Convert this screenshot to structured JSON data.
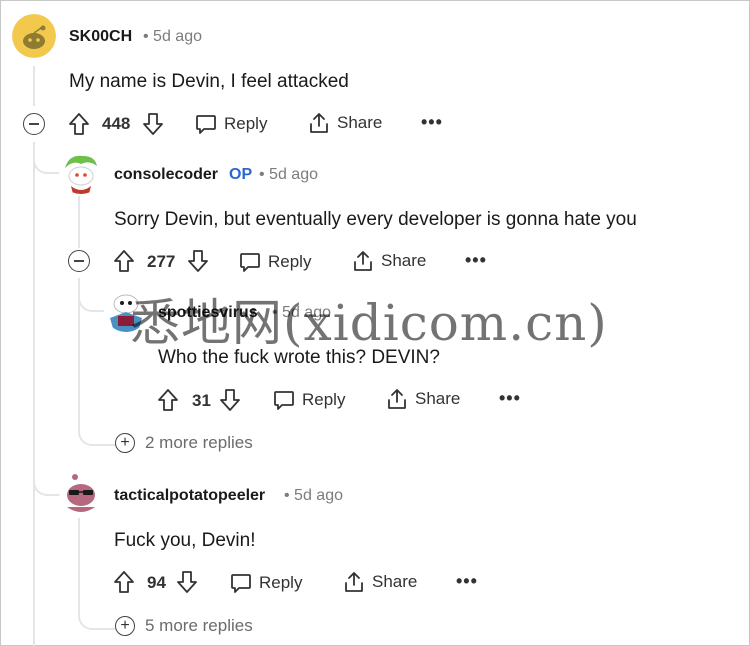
{
  "comments": [
    {
      "author": "SK00CH",
      "time": "• 5d ago",
      "body": "My name is Devin, I feel attacked",
      "votes": "448",
      "reply_label": "Reply",
      "share_label": "Share",
      "more_label": "•••"
    },
    {
      "author": "consolecoder",
      "op_badge": "OP",
      "time": "• 5d ago",
      "body": "Sorry Devin, but eventually every developer is gonna hate you",
      "votes": "277",
      "reply_label": "Reply",
      "share_label": "Share",
      "more_label": "•••"
    },
    {
      "author": "spottiesvirus",
      "time": "• 5d ago",
      "body": "Who the fuck wrote this? DEVIN?",
      "votes": "31",
      "reply_label": "Reply",
      "share_label": "Share",
      "more_label": "•••",
      "more_replies": "2 more replies"
    },
    {
      "author": "tacticalpotatopeeler",
      "time": "• 5d ago",
      "body": "Fuck you, Devin!",
      "votes": "94",
      "reply_label": "Reply",
      "share_label": "Share",
      "more_label": "•••",
      "more_replies": "5 more replies"
    }
  ],
  "watermark": "悉地网(xidicom.cn)",
  "colors": {
    "op": "#2a67d3",
    "thread_line": "#e3e6e8",
    "meta": "#7c7c7c"
  }
}
